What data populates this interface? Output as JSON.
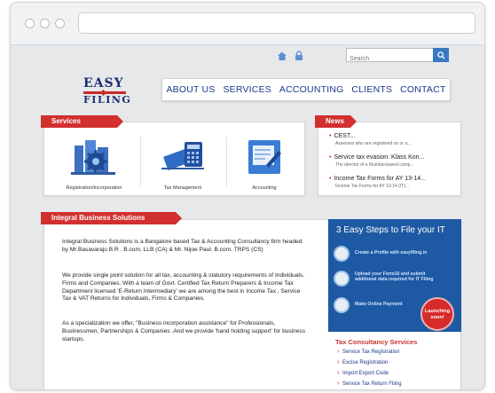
{
  "topbar": {
    "search_placeholder": "Search"
  },
  "logo": {
    "line1": "EASY",
    "line2": "FILING"
  },
  "nav": {
    "items": [
      "ABOUT US",
      "SERVICES",
      "ACCOUNTING",
      "CLIENTS",
      "CONTACT"
    ]
  },
  "services": {
    "title": "Services",
    "items": [
      {
        "label": "Registration/Incorporation",
        "icon": "gear-buildings-icon"
      },
      {
        "label": "Tax Management",
        "icon": "calculator-icon"
      },
      {
        "label": "Accounting",
        "icon": "pencil-document-icon"
      }
    ]
  },
  "news": {
    "title": "News",
    "items": [
      {
        "headline": "CEST...",
        "summary": "Assesses who are registered on or a..."
      },
      {
        "headline": "Service tax evasion: Klass Kon...",
        "summary": "The director of a Mumbai-based comp..."
      },
      {
        "headline": "Income Tax Forms for AY 13-14...",
        "summary": "Income Tax Forms for AY 13-14 (IT)..."
      }
    ]
  },
  "ibs": {
    "title": "Integral Business Solutions",
    "paragraphs": [
      "Integral Business Solutions is a Bangalore based Tax & Accounting Consultancy firm headed by Mr.Basavaraju B.R . B.com, LLB (CA) & Mr. Nijoe Paul. B.com, TRPS (CS)",
      "We provide single point solution for all tax, accounting & statutory requirements of Individuals, Firms and Companies. With a team of Govt. Certified Tax Return Preparers & Income Tax Department licensed 'E-Return Intermediary' we are among the best in Income Tax , Service Tax & VAT Returns for Individuals, Firms & Companies.",
      "As a specialization we offer, \"Business incorporation assistance\" for Professionals, Businessmen, Partnerships & Companies .And we provide 'hand holding support' for business startups."
    ]
  },
  "steps": {
    "title": "3 Easy Steps to File your IT",
    "items": [
      "Create a Profile with easyfiling.in",
      "Upload your Form16 and submit additional data required for IT Filing",
      "Make Online Payment"
    ],
    "badge": "Launching soon!"
  },
  "tax_consultancy": {
    "title": "Tax Consultancy Services",
    "links": [
      "Service Tax Registration",
      "Excise Registration",
      "Import Export Code",
      "Service Tax Return Filing"
    ]
  },
  "colors": {
    "accent_red": "#d22f2f",
    "nav_blue": "#1a3a8a",
    "panel_blue": "#1e5aa3"
  }
}
